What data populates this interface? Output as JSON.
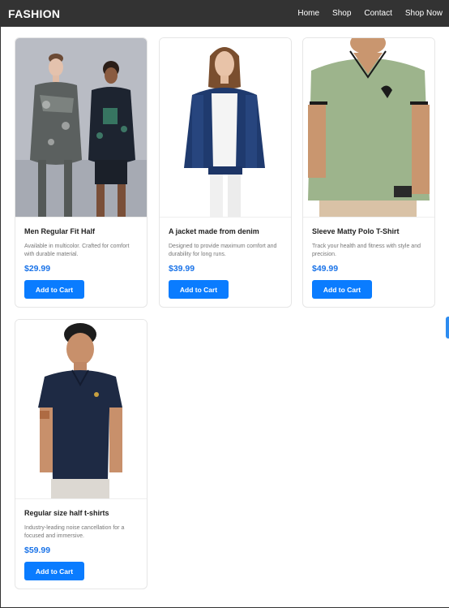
{
  "navbar": {
    "brand": "FASHION",
    "links": [
      "Home",
      "Shop",
      "Contact",
      "Shop Now"
    ]
  },
  "products": [
    {
      "title": "Men Regular Fit Half",
      "description": "Available in multicolor. Crafted for comfort with durable material.",
      "price": "$29.99",
      "button": "Add to Cart",
      "image_icon": "fashion-duo-photo"
    },
    {
      "title": "A jacket made from denim",
      "description": "Designed to provide maximum comfort and durability for long runs.",
      "price": "$39.99",
      "button": "Add to Cart",
      "image_icon": "denim-jacket-photo"
    },
    {
      "title": "Sleeve Matty Polo T-Shirt",
      "description": "Track your health and fitness with style and precision.",
      "price": "$49.99",
      "button": "Add to Cart",
      "image_icon": "green-polo-photo"
    },
    {
      "title": "Regular size half t-shirts",
      "description": "Industry-leading noise cancellation for a focused and immersive.",
      "price": "$59.99",
      "button": "Add to Cart",
      "image_icon": "navy-polo-photo"
    }
  ],
  "colors": {
    "navbar": "#333333",
    "accent": "#0a7cff",
    "price": "#1a73e8"
  }
}
